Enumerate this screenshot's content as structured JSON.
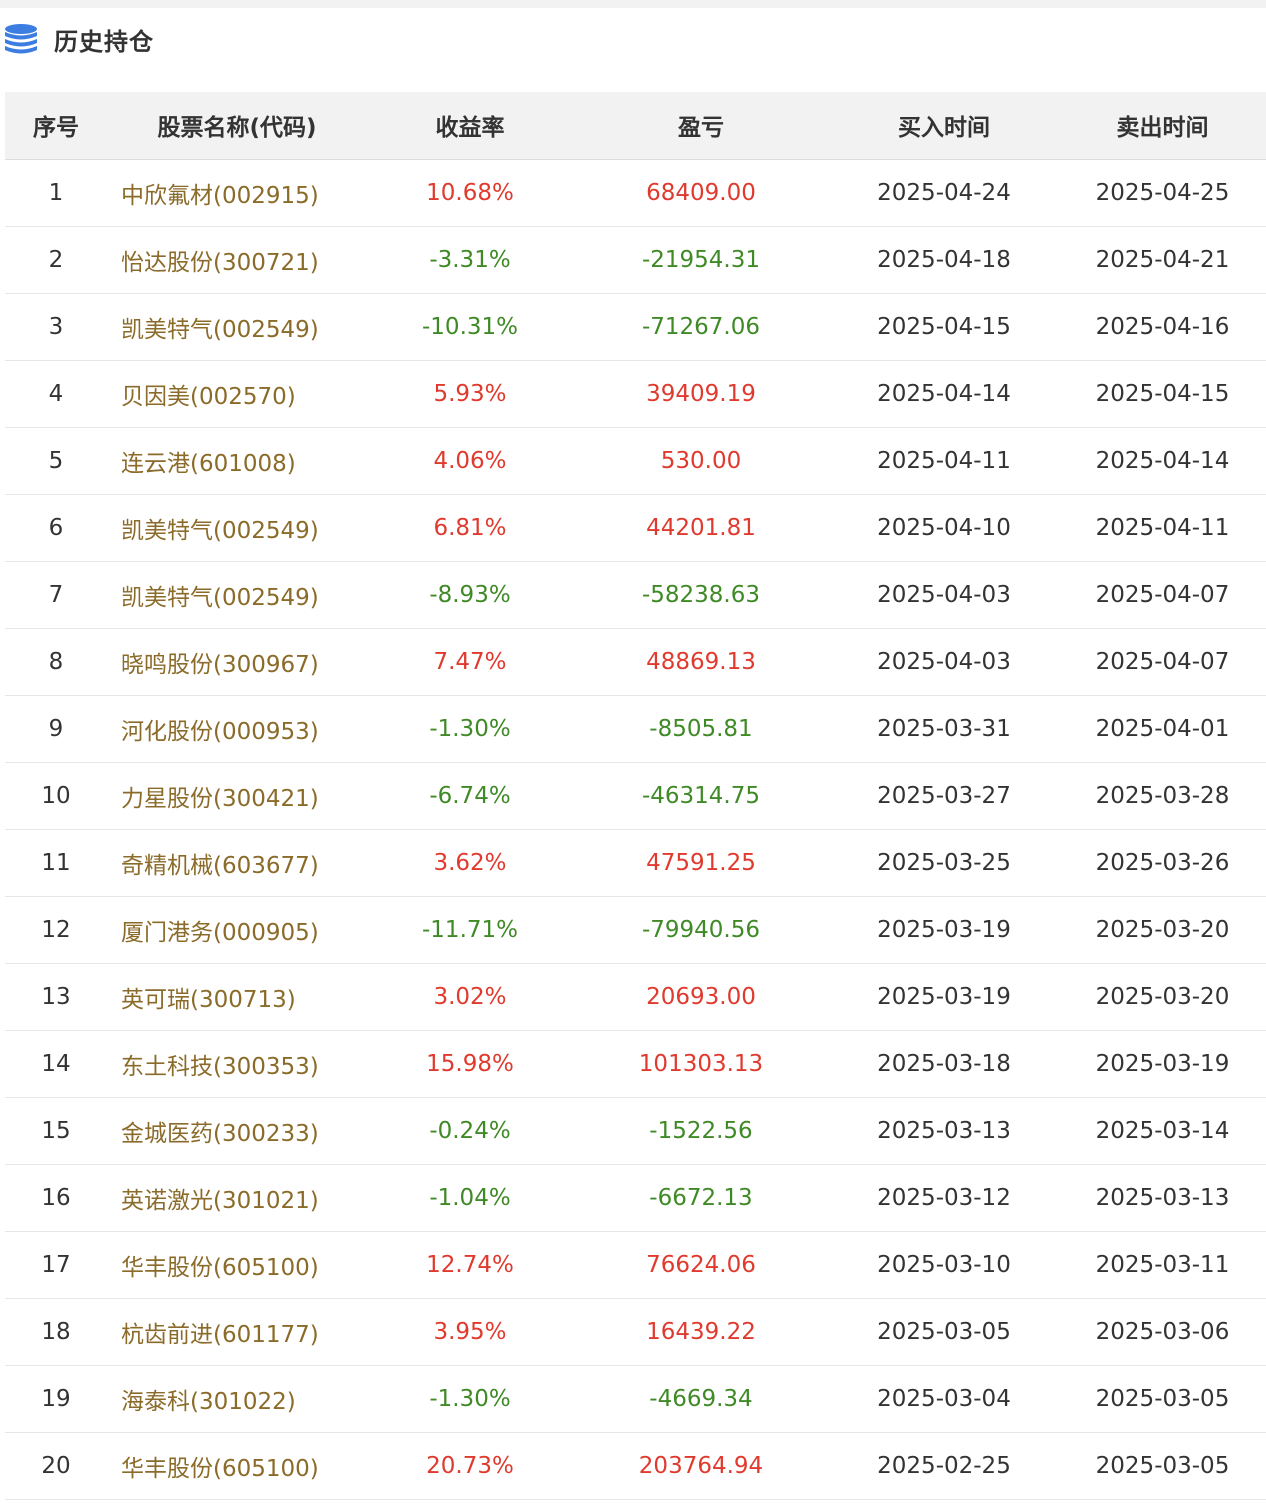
{
  "section": {
    "title": "历史持仓",
    "icon": "database-icon"
  },
  "colors": {
    "gain": "#e03a2e",
    "loss": "#3f8a26",
    "name": "#8b6b29",
    "header_bg": "#f2f2f2"
  },
  "table": {
    "columns": [
      "序号",
      "股票名称(代码)",
      "收益率",
      "盈亏",
      "买入时间",
      "卖出时间"
    ],
    "rows": [
      {
        "no": "1",
        "name": "中欣氟材(002915)",
        "rate": "10.68%",
        "pnl": "68409.00",
        "buy": "2025-04-24",
        "sell": "2025-04-25",
        "trend": "up"
      },
      {
        "no": "2",
        "name": "怡达股份(300721)",
        "rate": "-3.31%",
        "pnl": "-21954.31",
        "buy": "2025-04-18",
        "sell": "2025-04-21",
        "trend": "down"
      },
      {
        "no": "3",
        "name": "凯美特气(002549)",
        "rate": "-10.31%",
        "pnl": "-71267.06",
        "buy": "2025-04-15",
        "sell": "2025-04-16",
        "trend": "down"
      },
      {
        "no": "4",
        "name": "贝因美(002570)",
        "rate": "5.93%",
        "pnl": "39409.19",
        "buy": "2025-04-14",
        "sell": "2025-04-15",
        "trend": "up"
      },
      {
        "no": "5",
        "name": "连云港(601008)",
        "rate": "4.06%",
        "pnl": "530.00",
        "buy": "2025-04-11",
        "sell": "2025-04-14",
        "trend": "up"
      },
      {
        "no": "6",
        "name": "凯美特气(002549)",
        "rate": "6.81%",
        "pnl": "44201.81",
        "buy": "2025-04-10",
        "sell": "2025-04-11",
        "trend": "up"
      },
      {
        "no": "7",
        "name": "凯美特气(002549)",
        "rate": "-8.93%",
        "pnl": "-58238.63",
        "buy": "2025-04-03",
        "sell": "2025-04-07",
        "trend": "down"
      },
      {
        "no": "8",
        "name": "晓鸣股份(300967)",
        "rate": "7.47%",
        "pnl": "48869.13",
        "buy": "2025-04-03",
        "sell": "2025-04-07",
        "trend": "up"
      },
      {
        "no": "9",
        "name": "河化股份(000953)",
        "rate": "-1.30%",
        "pnl": "-8505.81",
        "buy": "2025-03-31",
        "sell": "2025-04-01",
        "trend": "down"
      },
      {
        "no": "10",
        "name": "力星股份(300421)",
        "rate": "-6.74%",
        "pnl": "-46314.75",
        "buy": "2025-03-27",
        "sell": "2025-03-28",
        "trend": "down"
      },
      {
        "no": "11",
        "name": "奇精机械(603677)",
        "rate": "3.62%",
        "pnl": "47591.25",
        "buy": "2025-03-25",
        "sell": "2025-03-26",
        "trend": "up"
      },
      {
        "no": "12",
        "name": "厦门港务(000905)",
        "rate": "-11.71%",
        "pnl": "-79940.56",
        "buy": "2025-03-19",
        "sell": "2025-03-20",
        "trend": "down"
      },
      {
        "no": "13",
        "name": "英可瑞(300713)",
        "rate": "3.02%",
        "pnl": "20693.00",
        "buy": "2025-03-19",
        "sell": "2025-03-20",
        "trend": "up"
      },
      {
        "no": "14",
        "name": "东土科技(300353)",
        "rate": "15.98%",
        "pnl": "101303.13",
        "buy": "2025-03-18",
        "sell": "2025-03-19",
        "trend": "up"
      },
      {
        "no": "15",
        "name": "金城医药(300233)",
        "rate": "-0.24%",
        "pnl": "-1522.56",
        "buy": "2025-03-13",
        "sell": "2025-03-14",
        "trend": "down"
      },
      {
        "no": "16",
        "name": "英诺激光(301021)",
        "rate": "-1.04%",
        "pnl": "-6672.13",
        "buy": "2025-03-12",
        "sell": "2025-03-13",
        "trend": "down"
      },
      {
        "no": "17",
        "name": "华丰股份(605100)",
        "rate": "12.74%",
        "pnl": "76624.06",
        "buy": "2025-03-10",
        "sell": "2025-03-11",
        "trend": "up"
      },
      {
        "no": "18",
        "name": "杭齿前进(601177)",
        "rate": "3.95%",
        "pnl": "16439.22",
        "buy": "2025-03-05",
        "sell": "2025-03-06",
        "trend": "up"
      },
      {
        "no": "19",
        "name": "海泰科(301022)",
        "rate": "-1.30%",
        "pnl": "-4669.34",
        "buy": "2025-03-04",
        "sell": "2025-03-05",
        "trend": "down"
      },
      {
        "no": "20",
        "name": "华丰股份(605100)",
        "rate": "20.73%",
        "pnl": "203764.94",
        "buy": "2025-02-25",
        "sell": "2025-03-05",
        "trend": "up"
      }
    ]
  }
}
